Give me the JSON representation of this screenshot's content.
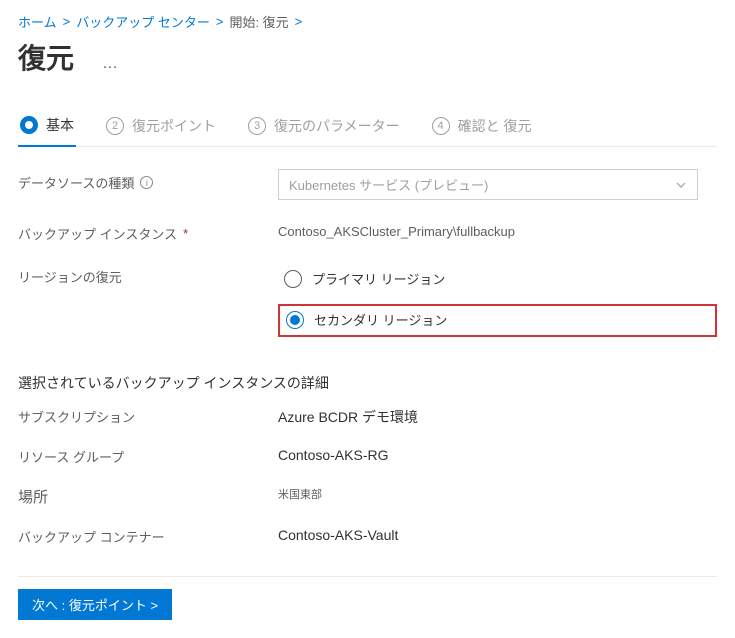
{
  "breadcrumb": {
    "items": [
      "ホーム",
      "バックアップ センター",
      "開始: 復元"
    ]
  },
  "title": "復元",
  "tabs": {
    "items": [
      {
        "num": "1",
        "label": "基本",
        "active": true
      },
      {
        "num": "2",
        "label": "復元ポイント",
        "active": false
      },
      {
        "num": "3",
        "label": "復元のパラメーター",
        "active": false
      },
      {
        "num": "4",
        "label": "確認と 復元",
        "active": false
      }
    ]
  },
  "form": {
    "datasource_type_label": "データソースの種類",
    "datasource_type_value": "Kubernetes サービス (プレビュー)",
    "backup_instance_label": "バックアップ インスタンス",
    "backup_instance_asterisk": "*",
    "backup_instance_value": "Contoso_AKSCluster_Primary\\fullbackup",
    "region_label": "リージョンの復元",
    "region_options": {
      "primary": "プライマリ リージョン",
      "secondary": "セカンダリ リージョン"
    }
  },
  "section_heading": "選択されているバックアップ インスタンスの詳細",
  "details": {
    "subscription_label": "サブスクリプション",
    "subscription_value": "Azure  BCDR デモ環境",
    "rg_label": "リソース グループ",
    "rg_value": "Contoso-AKS-RG",
    "location_label": "場所",
    "location_value": "米国東部",
    "container_label": "バックアップ コンテナー",
    "container_value": "Contoso-AKS-Vault"
  },
  "footer": {
    "next_label": "次へ : 復元ポイント  >"
  }
}
